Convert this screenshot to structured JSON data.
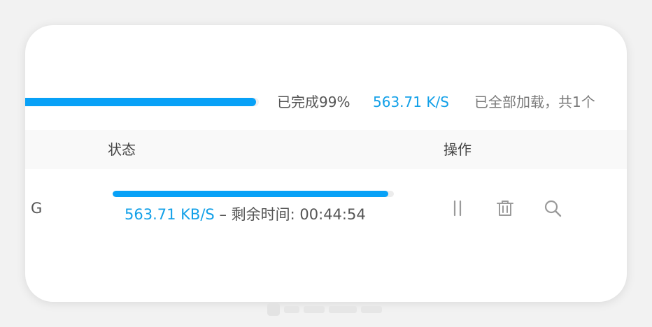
{
  "summary": {
    "progress_label": "已完成99%",
    "speed": "563.71 K/S",
    "loaded_label": "已全部加载，共1个",
    "progress": 0.99
  },
  "table": {
    "headers": {
      "status": "状态",
      "actions": "操作"
    }
  },
  "row": {
    "name_fragment": "G",
    "progress": 0.98,
    "speed": "563.71 KB/S",
    "separator": "–",
    "remaining_label": "剩余时间:",
    "remaining_time": "00:44:54"
  },
  "icons": {
    "pause": "pause-icon",
    "delete": "trash-icon",
    "search": "search-icon"
  },
  "colors": {
    "accent": "#08a1f7",
    "accent_text": "#12a0e8",
    "icon": "#9a9a9a"
  }
}
